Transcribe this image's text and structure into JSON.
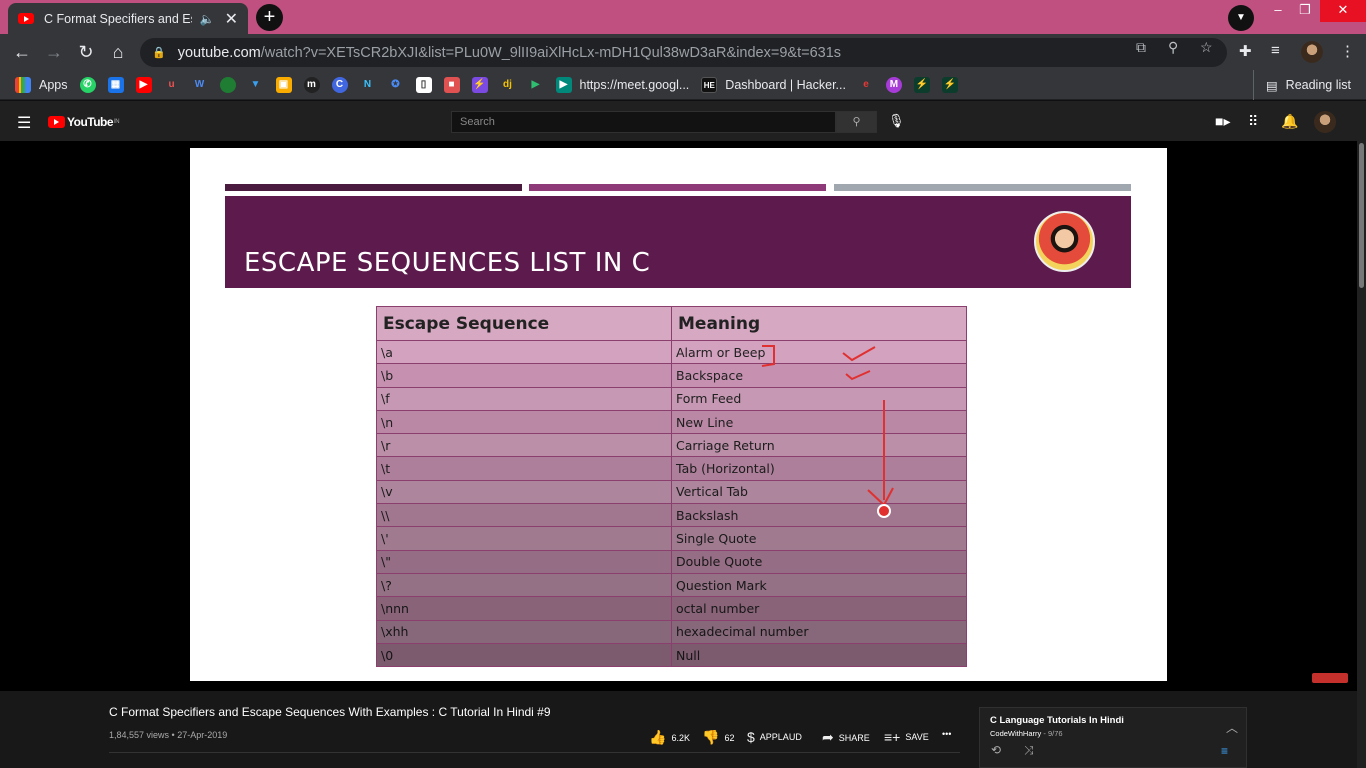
{
  "browser": {
    "tab_title": "C Format Specifiers and Escape Sequences With Examples",
    "tab_sound_icon": "speaker-icon",
    "url_host": "youtube.com",
    "url_path": "/watch?v=XETsCR2bXJI&list=PLu0W_9lII9aiXlHcLx-mDH1Qul38wD3aR&index=9&t=631s",
    "new_tab_label": "+",
    "minimize": "–",
    "restore": "❐",
    "close": "✕"
  },
  "bookmarks": {
    "apps": "Apps",
    "meet": "https://meet.googl...",
    "hacker": "Dashboard | Hacker...",
    "reading_list": "Reading list"
  },
  "youtube": {
    "logo": "YouTube",
    "region": "IN",
    "search_placeholder": "Search"
  },
  "slide": {
    "title": "ESCAPE SEQUENCES LIST IN C",
    "colors": {
      "banner": "#5c1b4c",
      "bar1": "#4a1a3f",
      "bar2": "#8f3a78",
      "bar3": "#a1a7ae"
    },
    "table_headers": [
      "Escape Sequence",
      "Meaning"
    ],
    "table_rows": [
      [
        "\\a",
        "Alarm or Beep"
      ],
      [
        "\\b",
        "Backspace"
      ],
      [
        "\\f",
        "Form Feed"
      ],
      [
        "\\n",
        "New Line"
      ],
      [
        "\\r",
        "Carriage Return"
      ],
      [
        "\\t",
        "Tab (Horizontal)"
      ],
      [
        "\\v",
        "Vertical Tab"
      ],
      [
        "\\\\",
        "Backslash"
      ],
      [
        "\\'",
        "Single Quote"
      ],
      [
        "\\\"",
        "Double Quote"
      ],
      [
        "\\?",
        "Question Mark"
      ],
      [
        "\\nnn",
        "octal number"
      ],
      [
        "\\xhh",
        "hexadecimal number"
      ],
      [
        "\\0",
        "Null"
      ]
    ]
  },
  "video": {
    "title": "C Format Specifiers and Escape Sequences With Examples : C Tutorial In Hindi #9",
    "meta": "1,84,557 views • 27-Apr-2019",
    "likes": "6.2K",
    "dislikes": "62",
    "applaud": "APPLAUD",
    "share": "SHARE",
    "save": "SAVE",
    "more": "•••"
  },
  "playlist": {
    "title": "C Language Tutorials In Hindi",
    "channel": "CodeWithHarry",
    "position": "- 9/76"
  }
}
